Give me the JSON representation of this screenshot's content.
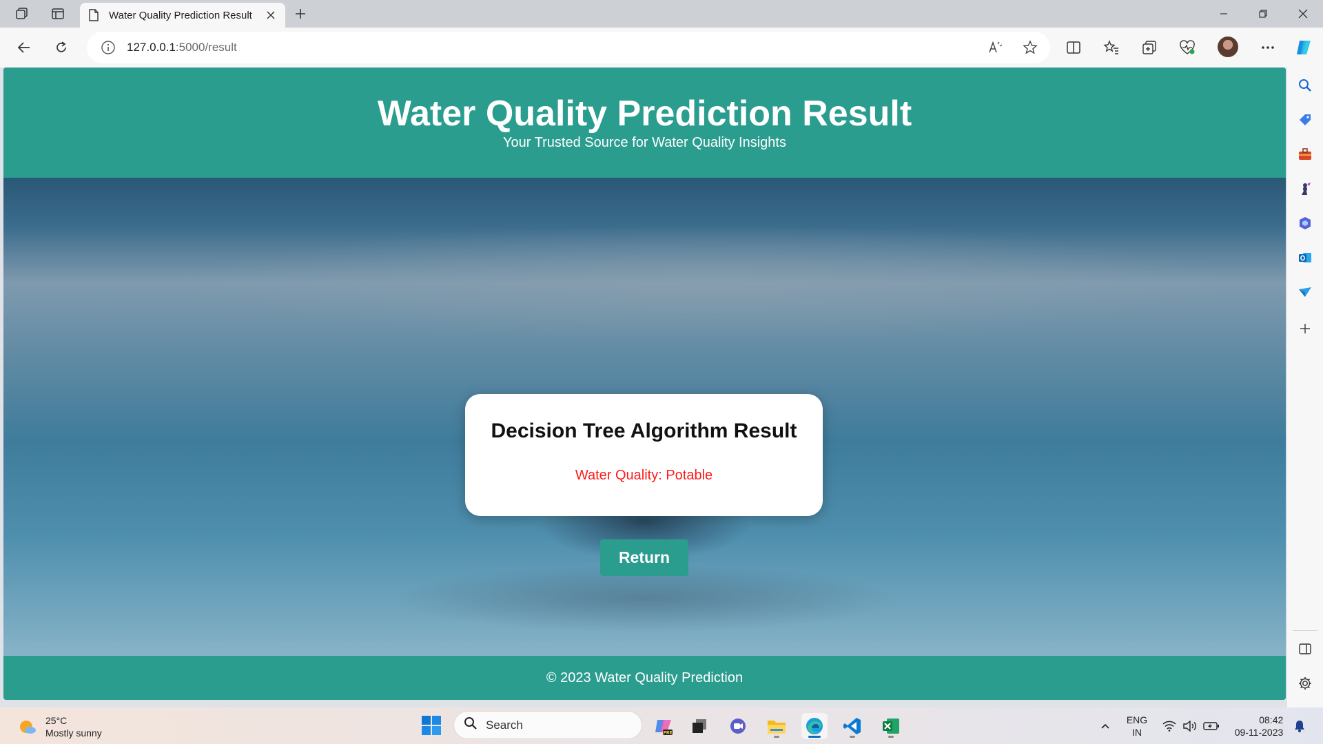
{
  "browser": {
    "tab_title": "Water Quality Prediction Result",
    "url_host": "127.0.0.1",
    "url_rest": ":5000/result"
  },
  "page": {
    "header_title": "Water Quality Prediction Result",
    "header_subtitle": "Your Trusted Source for Water Quality Insights",
    "card_title": "Decision Tree Algorithm Result",
    "result_text": "Water Quality: Potable",
    "return_label": "Return",
    "footer_text": "© 2023 Water Quality Prediction"
  },
  "colors": {
    "brand_teal": "#2a9d8f",
    "result_red": "#ff1a1a"
  },
  "taskbar": {
    "temperature": "25°C",
    "weather_desc": "Mostly sunny",
    "search_label": "Search",
    "lang_top": "ENG",
    "lang_bottom": "IN",
    "time": "08:42",
    "date": "09-11-2023"
  }
}
